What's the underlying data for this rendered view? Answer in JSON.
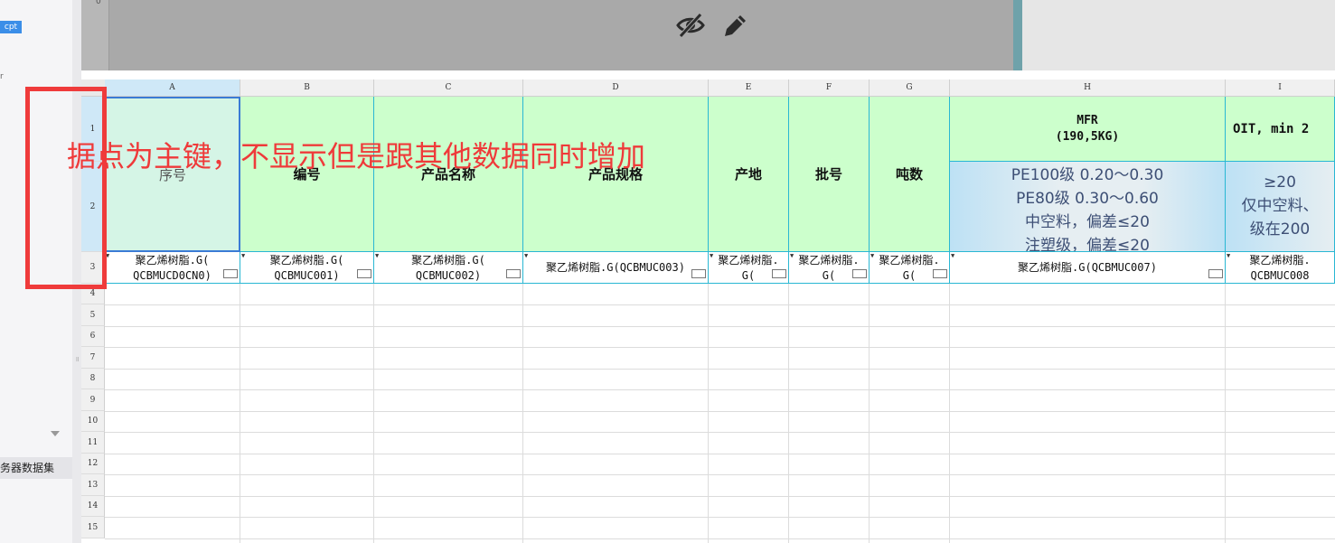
{
  "left_panel": {
    "cpt_tag": "cpt",
    "tree_glyph": "r",
    "server_dataset": "务器数据集"
  },
  "preview": {
    "ruler_label": "0",
    "icons": [
      "eye-slash-icon",
      "pencil-icon"
    ]
  },
  "columns": [
    "A",
    "B",
    "C",
    "D",
    "E",
    "F",
    "G",
    "H",
    "I"
  ],
  "rows": [
    "1",
    "2",
    "3",
    "4",
    "5",
    "6",
    "7",
    "8",
    "9",
    "10",
    "11",
    "12",
    "13",
    "14",
    "15"
  ],
  "headers": {
    "a": "序号",
    "b": "编号",
    "c": "产品名称",
    "d": "产品规格",
    "e": "产地",
    "f": "批号",
    "g": "吨数",
    "h_top": "MFR\n(190,5KG)",
    "h_bottom": [
      "PE100级 0.20～0.30",
      "PE80级 0.30～0.60",
      "中空料，偏差≤20",
      "注塑级，偏差≤20"
    ],
    "i_top": "OIT, min 2",
    "i_bottom": "≥20\n仅中空料、\n级在200"
  },
  "row3": {
    "a": "聚乙烯树脂.G(\nQCBMUCD0CN0)",
    "b": "聚乙烯树脂.G(\nQCBMUC001)",
    "c": "聚乙烯树脂.G(\nQCBMUC002)",
    "d": "聚乙烯树脂.G(QCBMUC003)",
    "e": "聚乙烯树脂.\nG(",
    "f": "聚乙烯树脂.\nG(",
    "g": "聚乙烯树脂.\nG(",
    "h": "聚乙烯树脂.G(QCBMUC007)",
    "i": "聚乙烯树脂.\nQCBMUC008"
  },
  "annotation": {
    "text": "据点为主键，不显示但是跟其他数据同时增加",
    "color": "#ef3a3a"
  }
}
